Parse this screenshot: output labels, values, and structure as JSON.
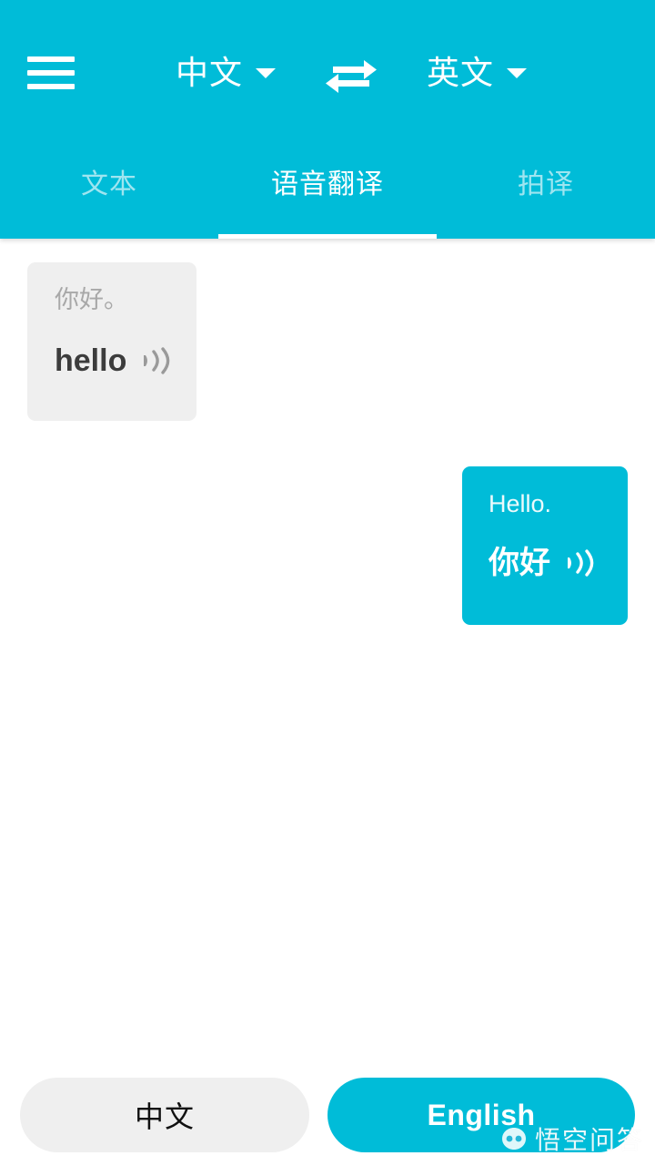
{
  "header": {
    "background_color": "#00bcd8",
    "menu_icon": "hamburger-menu-icon",
    "source_language": "中文",
    "target_language": "英文",
    "swap_icon": "swap-horizontal-arrows-icon",
    "caret_icon": "chevron-down-icon"
  },
  "tabs": [
    {
      "label": "文本",
      "active": false
    },
    {
      "label": "语音翻译",
      "active": true
    },
    {
      "label": "拍译",
      "active": false
    }
  ],
  "conversation": {
    "messages": [
      {
        "side": "incoming",
        "source_text": "你好。",
        "translated_text": "hello",
        "speaker_icon": "sound-wave-icon"
      },
      {
        "side": "outgoing",
        "source_text": "Hello.",
        "translated_text": "你好",
        "speaker_icon": "sound-wave-icon"
      }
    ]
  },
  "bottom_bar": {
    "left_button": {
      "label": "中文",
      "style": "secondary"
    },
    "right_button": {
      "label": "English",
      "style": "primary"
    }
  },
  "watermark": {
    "text": "悟空问答",
    "logo_icon": "wukong-logo-icon"
  },
  "colors": {
    "accent": "#00bcd8",
    "bubble_gray": "#efefef",
    "text_dark": "#3c3c3c",
    "text_muted": "#a8a8a8"
  }
}
